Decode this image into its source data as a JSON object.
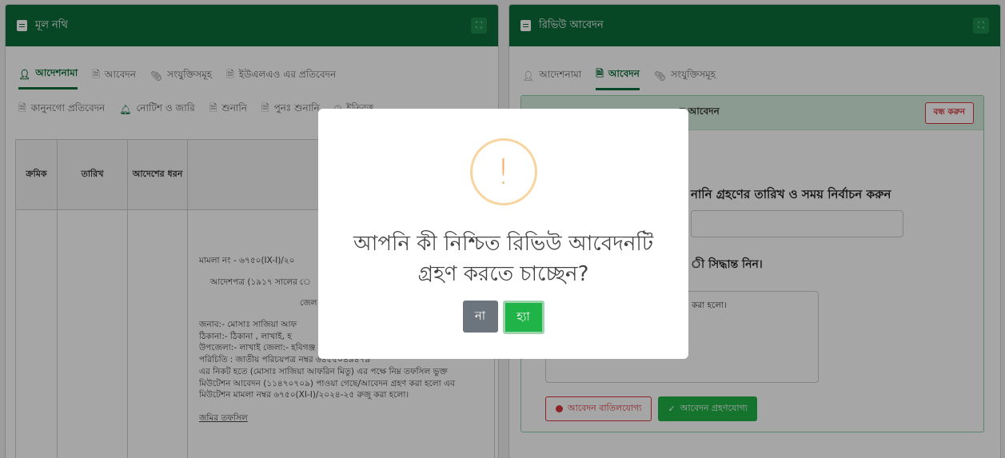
{
  "left_panel": {
    "title": "মূল নথি",
    "tabs_row1": [
      {
        "label": "আদেশনামা",
        "icon": "user-icon",
        "active": true
      },
      {
        "label": "আবেদন",
        "icon": "file-icon",
        "active": false
      },
      {
        "label": "সংযুক্তিসমূহ",
        "icon": "paperclip-icon",
        "active": false
      },
      {
        "label": "ইউএলএও এর প্রতিবেদন",
        "icon": "file-icon",
        "active": false
      }
    ],
    "tabs_row2": [
      {
        "label": "কানুনগো প্রতিবেদন",
        "icon": "file-icon"
      },
      {
        "label": "নোটিশ ও জারি",
        "icon": "bell-icon"
      },
      {
        "label": "শুনানি",
        "icon": "file-icon"
      },
      {
        "label": "পুনঃ শুনানি",
        "icon": "file-icon"
      },
      {
        "label": "ইতিবৃত্ত",
        "icon": "clock-icon"
      }
    ],
    "table": {
      "headers": [
        "ক্রমিক",
        "তারিখ",
        "আদেশের ধরন"
      ],
      "doc_lines": [
        "মামলা নং - ৬৭৫০(IX-I)/২০",
        "আদেশপত্র (১৯১৭ সালের ে",
        "জেল",
        "জনাব:- মোসাঃ সাজিয়া আফ",
        "ঠিকানা:- ঠিকানা , লাখাই, হ",
        "উপজেলা:- লাখাই জেলা:- হবিগঞ্জ",
        "পরিচিতি : জাতীয় পরিচয়পত্র নম্বর ৬৪৫৫০৪৯৪৭৯",
        "এর নিকট হতে (মোসাঃ সাজিয়া আফরিন মিতু) এর পক্ষে নিম্ন তফসিল ভুক্ত",
        "মিউটেশন আবেদন (১১৪৭০৭০৯) পাওয়া গেছে/আবেদন গ্রহণ করা হলো এব",
        "মিউটেশন মামলা নম্বর ৬৭৫০(XI-I)/২০২৪-২৫ রুজু করা হলো।"
      ],
      "land_schedule": "জমির তফসিল"
    }
  },
  "right_panel": {
    "title": "রিভিউ আবেদন",
    "tabs": [
      {
        "label": "আদেশনামা",
        "icon": "user-icon",
        "active": false
      },
      {
        "label": "আবেদন",
        "icon": "file-icon",
        "active": true
      },
      {
        "label": "সংযুক্তিসমূহ",
        "icon": "paperclip-icon",
        "active": false
      }
    ],
    "box_title": "র আবেদন",
    "close_button": "বন্ধ করুন",
    "hearing_label": "নানি গ্রহণের তারিখ ও সময় নির্বাচন করুন",
    "decision_label": "ী সিদ্ধান্ত নিন।",
    "textarea_text": "করা হলো।",
    "reject_button": "আবেদন বাতিলযোগ্য",
    "accept_button": "আবেদন গ্রহণযোগ্য"
  },
  "modal": {
    "icon": "warning-icon",
    "message": "আপনি কী নিশ্চিত রিভিউ আবেদনটি গ্রহণ করতে চাচ্ছেন?",
    "no_label": "না",
    "yes_label": "হ্যা"
  },
  "colors": {
    "header_green": "#0d6e3b",
    "yes_green": "#1fb348",
    "danger": "#d9363e"
  }
}
